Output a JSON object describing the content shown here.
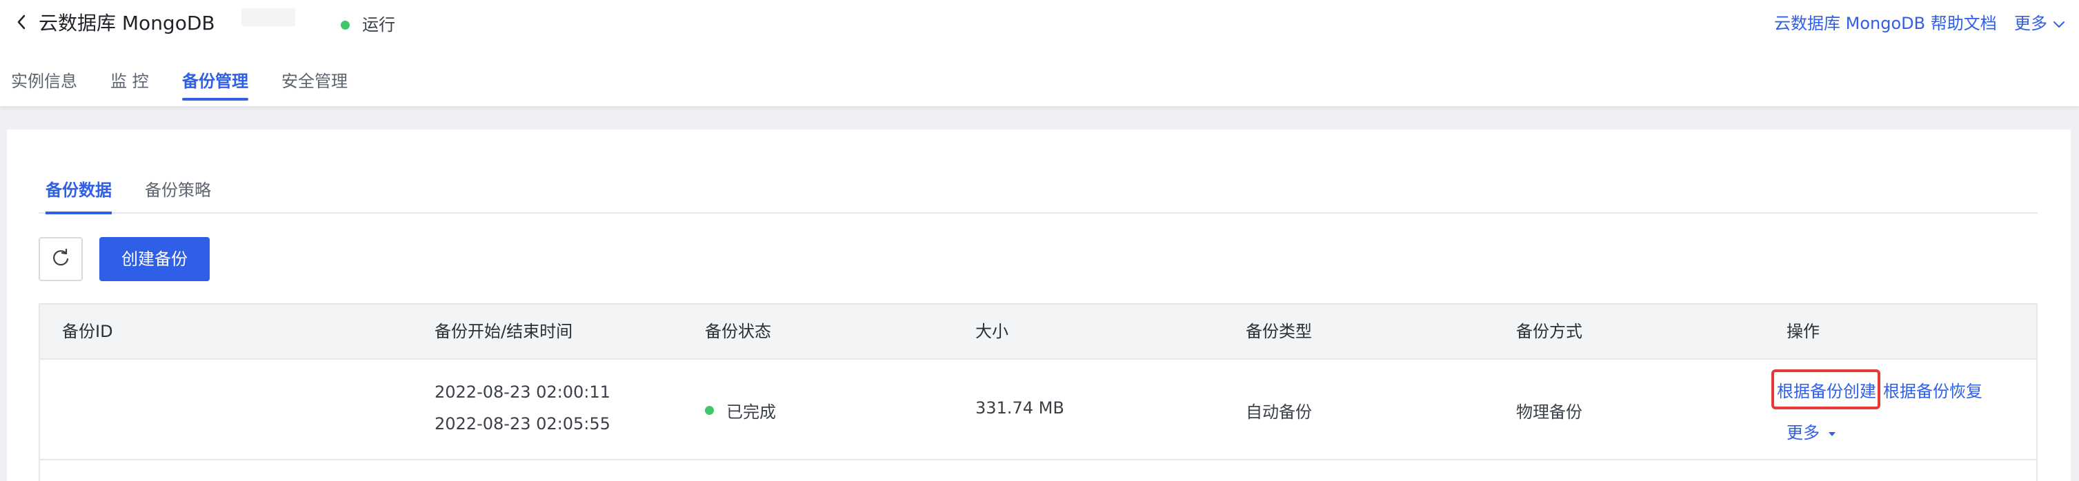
{
  "header": {
    "title": "云数据库 MongoDB",
    "status_text": "运行",
    "help_link": "云数据库 MongoDB 帮助文档",
    "more_label": "更多"
  },
  "nav_tabs": [
    {
      "label": "实例信息"
    },
    {
      "label": "监 控"
    },
    {
      "label": "备份管理",
      "active": true
    },
    {
      "label": "安全管理"
    }
  ],
  "sub_tabs": [
    {
      "label": "备份数据",
      "active": true
    },
    {
      "label": "备份策略"
    }
  ],
  "toolbar": {
    "refresh_icon": "refresh-icon",
    "create_label": "创建备份"
  },
  "table": {
    "columns": [
      "备份ID",
      "备份开始/结束时间",
      "备份状态",
      "大小",
      "备份类型",
      "备份方式",
      "操作"
    ],
    "rows": [
      {
        "id": "",
        "start_time": "2022-08-23 02:00:11",
        "end_time": "2022-08-23 02:05:55",
        "status": "已完成",
        "size": "331.74 MB",
        "type": "自动备份",
        "method": "物理备份",
        "actions": {
          "create_from_backup": "根据备份创建",
          "restore_from_backup": "根据备份恢复",
          "more": "更多"
        }
      }
    ]
  },
  "colors": {
    "accent": "#2f5fe6",
    "status_green": "#3ec86b",
    "highlight_red": "#e53935"
  }
}
